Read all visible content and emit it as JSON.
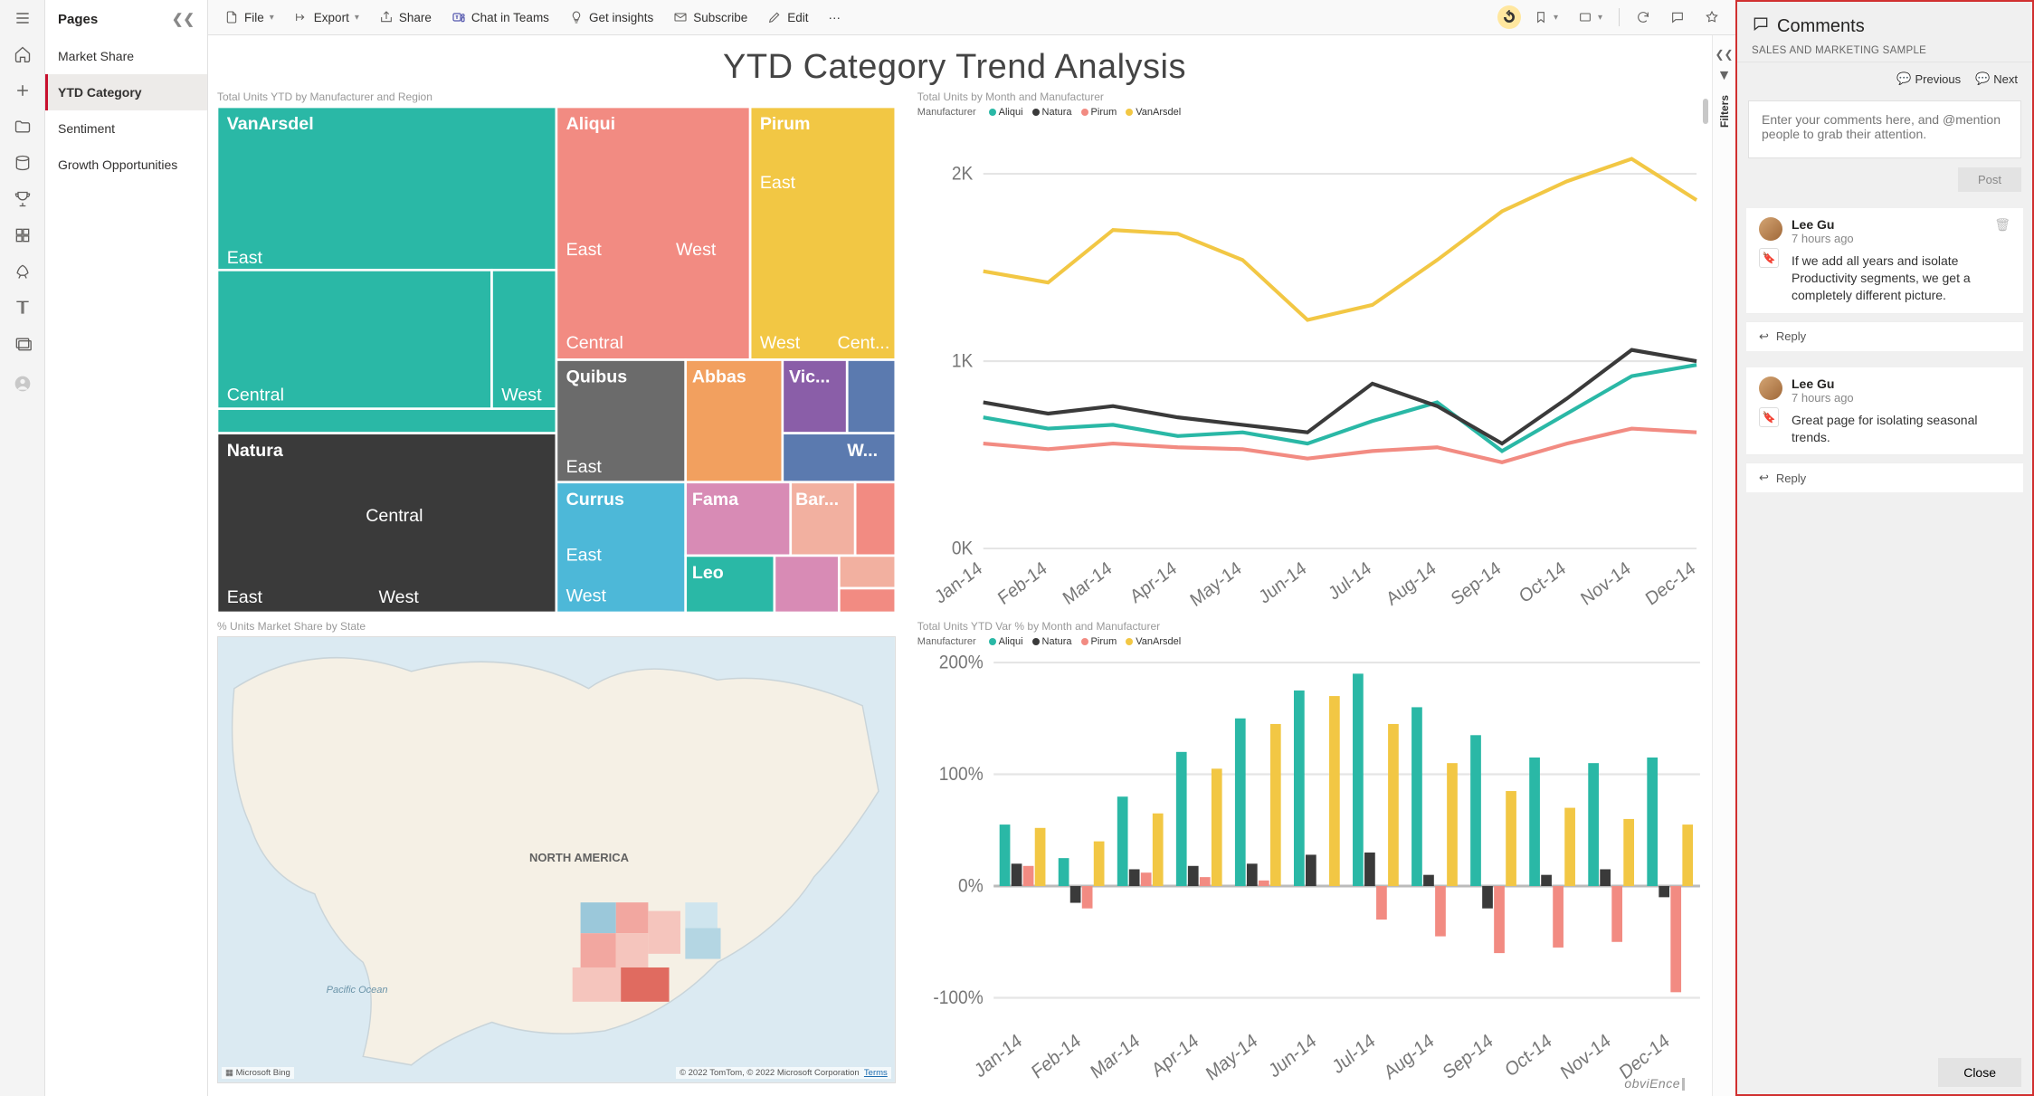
{
  "toolbar": {
    "file": "File",
    "export": "Export",
    "share": "Share",
    "chat": "Chat in Teams",
    "insights": "Get insights",
    "subscribe": "Subscribe",
    "edit": "Edit"
  },
  "pages": {
    "title": "Pages",
    "items": [
      {
        "label": "Market Share",
        "active": false
      },
      {
        "label": "YTD Category",
        "active": true
      },
      {
        "label": "Sentiment",
        "active": false
      },
      {
        "label": "Growth Opportunities",
        "active": false
      }
    ]
  },
  "report": {
    "title": "YTD Category Trend Analysis",
    "brand": "obviEnce",
    "filters_label": "Filters"
  },
  "viz": {
    "treemap": {
      "title": "Total Units YTD by Manufacturer and Region"
    },
    "line": {
      "title": "Total Units by Month and Manufacturer",
      "legend_label": "Manufacturer",
      "legend_items": [
        "Aliqui",
        "Natura",
        "Pirum",
        "VanArsdel"
      ]
    },
    "map": {
      "title": "% Units Market Share by State",
      "continent": "NORTH AMERICA",
      "ocean": "Pacific Ocean",
      "bing": "Microsoft Bing",
      "attribution": "© 2022 TomTom, © 2022 Microsoft Corporation",
      "terms": "Terms"
    },
    "bar": {
      "title": "Total Units YTD Var % by Month and Manufacturer",
      "legend_label": "Manufacturer",
      "legend_items": [
        "Aliqui",
        "Natura",
        "Pirum",
        "VanArsdel"
      ]
    }
  },
  "comments": {
    "header": "Comments",
    "subtitle": "SALES AND MARKETING SAMPLE",
    "prev": "Previous",
    "next": "Next",
    "placeholder": "Enter your comments here, and @mention people to grab their attention.",
    "post": "Post",
    "reply": "Reply",
    "close": "Close",
    "items": [
      {
        "author": "Lee Gu",
        "time": "7 hours ago",
        "body": "If we add all years and isolate Productivity segments, we get a completely different picture."
      },
      {
        "author": "Lee Gu",
        "time": "7 hours ago",
        "body": "Great page for isolating seasonal trends."
      }
    ]
  },
  "colors": {
    "aliqui": "#2ab8a6",
    "natura": "#3a3a3a",
    "pirum": "#f28b82",
    "vanarsdel": "#f2c744",
    "quibus": "#6b6b6b",
    "abbas": "#f2a05f",
    "victoria": "#8a5ea8",
    "currus": "#4db8d8",
    "fama": "#d88bb5",
    "barba": "#f2b0a0",
    "leo": "#2ab8a6",
    "w": "#5b7aaf"
  },
  "chart_data": [
    {
      "type": "treemap",
      "id": "treemap",
      "title": "Total Units YTD by Manufacturer and Region",
      "nodes": [
        {
          "name": "VanArsdel",
          "color": "aliqui",
          "children": [
            "East",
            "Central",
            "West"
          ]
        },
        {
          "name": "Natura",
          "color": "natura",
          "children": [
            "Central",
            "East",
            "West"
          ]
        },
        {
          "name": "Aliqui",
          "color": "pirum",
          "children": [
            "East",
            "West",
            "Central"
          ]
        },
        {
          "name": "Pirum",
          "color": "vanarsdel",
          "children": [
            "East",
            "West",
            "Cent..."
          ]
        },
        {
          "name": "Quibus",
          "color": "quibus",
          "children": [
            "East"
          ]
        },
        {
          "name": "Abbas",
          "color": "abbas",
          "children": []
        },
        {
          "name": "Vic...",
          "color": "victoria",
          "children": []
        },
        {
          "name": "W...",
          "color": "w",
          "children": []
        },
        {
          "name": "Currus",
          "color": "currus",
          "children": [
            "East",
            "West"
          ]
        },
        {
          "name": "Fama",
          "color": "fama",
          "children": []
        },
        {
          "name": "Bar...",
          "color": "barba",
          "children": []
        },
        {
          "name": "Leo",
          "color": "leo",
          "children": []
        }
      ]
    },
    {
      "type": "line",
      "id": "line",
      "title": "Total Units by Month and Manufacturer",
      "categories": [
        "Jan-14",
        "Feb-14",
        "Mar-14",
        "Apr-14",
        "May-14",
        "Jun-14",
        "Jul-14",
        "Aug-14",
        "Sep-14",
        "Oct-14",
        "Nov-14",
        "Dec-14"
      ],
      "y_ticks": [
        "0K",
        "1K",
        "2K"
      ],
      "ylim": [
        0,
        2200
      ],
      "series": [
        {
          "name": "Aliqui",
          "color": "aliqui",
          "values": [
            700,
            640,
            660,
            600,
            620,
            560,
            680,
            780,
            520,
            720,
            920,
            980
          ]
        },
        {
          "name": "Natura",
          "color": "natura",
          "values": [
            780,
            720,
            760,
            700,
            660,
            620,
            880,
            760,
            560,
            800,
            1060,
            1000
          ]
        },
        {
          "name": "Pirum",
          "color": "pirum",
          "values": [
            560,
            530,
            560,
            540,
            530,
            480,
            520,
            540,
            460,
            560,
            640,
            620
          ]
        },
        {
          "name": "VanArsdel",
          "color": "vanarsdel",
          "values": [
            1480,
            1420,
            1700,
            1680,
            1540,
            1220,
            1300,
            1540,
            1800,
            1960,
            2080,
            1860
          ]
        }
      ]
    },
    {
      "type": "bar",
      "id": "bar",
      "title": "Total Units YTD Var % by Month and Manufacturer",
      "categories": [
        "Jan-14",
        "Feb-14",
        "Mar-14",
        "Apr-14",
        "May-14",
        "Jun-14",
        "Jul-14",
        "Aug-14",
        "Sep-14",
        "Oct-14",
        "Nov-14",
        "Dec-14"
      ],
      "y_ticks": [
        "-100%",
        "0%",
        "100%",
        "200%"
      ],
      "ylim": [
        -120,
        200
      ],
      "series": [
        {
          "name": "Aliqui",
          "color": "aliqui",
          "values": [
            55,
            25,
            80,
            120,
            150,
            175,
            190,
            160,
            135,
            115,
            110,
            115
          ]
        },
        {
          "name": "Natura",
          "color": "natura",
          "values": [
            20,
            -15,
            15,
            18,
            20,
            28,
            30,
            10,
            -20,
            10,
            15,
            -10
          ]
        },
        {
          "name": "Pirum",
          "color": "pirum",
          "values": [
            18,
            -20,
            12,
            8,
            5,
            0,
            -30,
            -45,
            -60,
            -55,
            -50,
            -95
          ]
        },
        {
          "name": "VanArsdel",
          "color": "vanarsdel",
          "values": [
            52,
            40,
            65,
            105,
            145,
            170,
            145,
            110,
            85,
            70,
            60,
            55
          ]
        }
      ]
    }
  ]
}
